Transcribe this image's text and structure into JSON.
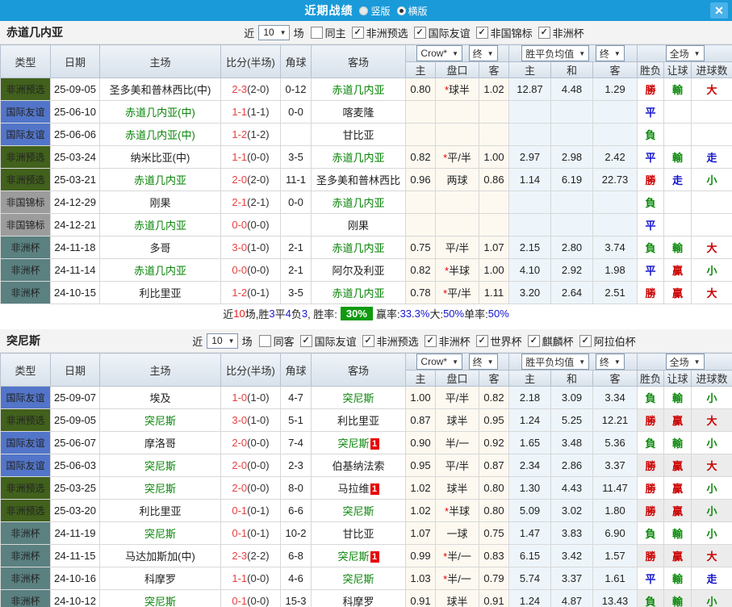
{
  "titlebar": {
    "title": "近期战绩",
    "layout_options": [
      {
        "label": "竖版",
        "selected": false
      },
      {
        "label": "横版",
        "selected": true
      }
    ],
    "close_label": "✕"
  },
  "table_header": {
    "type": "类型",
    "date": "日期",
    "home": "主场",
    "score": "比分(半场)",
    "corners": "角球",
    "away": "客场",
    "odds_group": {
      "bookmaker": "Crow*",
      "final": "终"
    },
    "mean_group": {
      "label": "胜平负均值",
      "final": "终"
    },
    "scope": "全场",
    "sub": {
      "home": "主",
      "line": "盘口",
      "away": "客",
      "m_home": "主",
      "m_draw": "和",
      "m_away": "客",
      "wl": "胜负",
      "handicap": "让球",
      "goals": "进球数"
    }
  },
  "filter_common": {
    "near": "近",
    "games": "场"
  },
  "colors": {
    "title_blue": "#1a9ad9",
    "focus_green": "#078407",
    "score_red": "#e84040",
    "win_red": "#cc0000",
    "lose_green": "#0b8a0b",
    "draw_blue": "#1515cc",
    "type_africa_qualifier": "#41611c",
    "type_friendly": "#5275c9",
    "type_non_championship": "#9c9c9c",
    "type_africa_cup": "#5a8080",
    "win_rate_badge_green": "#0f9a0f",
    "red_card_badge": "#e60000"
  },
  "sections": [
    {
      "team": "赤道几内亚",
      "count": "10",
      "same_label": "同主",
      "same_checked": false,
      "filters": [
        "非洲预选",
        "国际友谊",
        "非国锦标",
        "非洲杯"
      ],
      "rows": [
        {
          "type": "非洲预选",
          "date": "25-09-05",
          "home": "圣多美和普林西比(中)",
          "home_focus": false,
          "home_badge": "",
          "ft": "2-3",
          "ht": "(2-0)",
          "corners": "0-12",
          "away": "赤道几内亚",
          "away_focus": true,
          "away_badge": "",
          "o1": "0.80",
          "line": "*球半",
          "o2": "1.02",
          "m1": "12.87",
          "m2": "4.48",
          "m3": "1.29",
          "r1": "勝",
          "r2": "輸",
          "r3": "大"
        },
        {
          "type": "国际友谊",
          "date": "25-06-10",
          "home": "赤道几内亚(中)",
          "home_focus": true,
          "home_badge": "",
          "ft": "1-1",
          "ht": "(1-1)",
          "corners": "0-0",
          "away": "喀麦隆",
          "away_focus": false,
          "away_badge": "",
          "o1": "",
          "line": "",
          "o2": "",
          "m1": "",
          "m2": "",
          "m3": "",
          "r1": "平",
          "r2": "",
          "r3": ""
        },
        {
          "type": "国际友谊",
          "date": "25-06-06",
          "home": "赤道几内亚(中)",
          "home_focus": true,
          "home_badge": "",
          "ft": "1-2",
          "ht": "(1-2)",
          "corners": "",
          "away": "甘比亚",
          "away_focus": false,
          "away_badge": "",
          "o1": "",
          "line": "",
          "o2": "",
          "m1": "",
          "m2": "",
          "m3": "",
          "r1": "負",
          "r2": "",
          "r3": ""
        },
        {
          "type": "非洲预选",
          "date": "25-03-24",
          "home": "纳米比亚(中)",
          "home_focus": false,
          "home_badge": "",
          "ft": "1-1",
          "ht": "(0-0)",
          "corners": "3-5",
          "away": "赤道几内亚",
          "away_focus": true,
          "away_badge": "",
          "o1": "0.82",
          "line": "*平/半",
          "o2": "1.00",
          "m1": "2.97",
          "m2": "2.98",
          "m3": "2.42",
          "r1": "平",
          "r2": "輸",
          "r3": "走"
        },
        {
          "type": "非洲预选",
          "date": "25-03-21",
          "home": "赤道几内亚",
          "home_focus": true,
          "home_badge": "",
          "ft": "2-0",
          "ht": "(2-0)",
          "corners": "11-1",
          "away": "圣多美和普林西比",
          "away_focus": false,
          "away_badge": "",
          "o1": "0.96",
          "line": "两球",
          "o2": "0.86",
          "m1": "1.14",
          "m2": "6.19",
          "m3": "22.73",
          "r1": "勝",
          "r2": "走",
          "r3": "小"
        },
        {
          "type": "非国锦标",
          "date": "24-12-29",
          "home": "刚果",
          "home_focus": false,
          "home_badge": "",
          "ft": "2-1",
          "ht": "(2-1)",
          "corners": "0-0",
          "away": "赤道几内亚",
          "away_focus": true,
          "away_badge": "",
          "o1": "",
          "line": "",
          "o2": "",
          "m1": "",
          "m2": "",
          "m3": "",
          "r1": "負",
          "r2": "",
          "r3": ""
        },
        {
          "type": "非国锦标",
          "date": "24-12-21",
          "home": "赤道几内亚",
          "home_focus": true,
          "home_badge": "",
          "ft": "0-0",
          "ht": "(0-0)",
          "corners": "",
          "away": "刚果",
          "away_focus": false,
          "away_badge": "",
          "o1": "",
          "line": "",
          "o2": "",
          "m1": "",
          "m2": "",
          "m3": "",
          "r1": "平",
          "r2": "",
          "r3": ""
        },
        {
          "type": "非洲杯",
          "date": "24-11-18",
          "home": "多哥",
          "home_focus": false,
          "home_badge": "",
          "ft": "3-0",
          "ht": "(1-0)",
          "corners": "2-1",
          "away": "赤道几内亚",
          "away_focus": true,
          "away_badge": "",
          "o1": "0.75",
          "line": "平/半",
          "o2": "1.07",
          "m1": "2.15",
          "m2": "2.80",
          "m3": "3.74",
          "r1": "負",
          "r2": "輸",
          "r3": "大"
        },
        {
          "type": "非洲杯",
          "date": "24-11-14",
          "home": "赤道几内亚",
          "home_focus": true,
          "home_badge": "",
          "ft": "0-0",
          "ht": "(0-0)",
          "corners": "2-1",
          "away": "阿尔及利亚",
          "away_focus": false,
          "away_badge": "",
          "o1": "0.82",
          "line": "*半球",
          "o2": "1.00",
          "m1": "4.10",
          "m2": "2.92",
          "m3": "1.98",
          "r1": "平",
          "r2": "贏",
          "r3": "小"
        },
        {
          "type": "非洲杯",
          "date": "24-10-15",
          "home": "利比里亚",
          "home_focus": false,
          "home_badge": "",
          "ft": "1-2",
          "ht": "(0-1)",
          "corners": "3-5",
          "away": "赤道几内亚",
          "away_focus": true,
          "away_badge": "",
          "o1": "0.78",
          "line": "*平/半",
          "o2": "1.11",
          "m1": "3.20",
          "m2": "2.64",
          "m3": "2.51",
          "r1": "勝",
          "r2": "贏",
          "r3": "大"
        }
      ],
      "summary": {
        "parts": [
          {
            "t": "近",
            "c": ""
          },
          {
            "t": "10",
            "c": "red"
          },
          {
            "t": "场,胜",
            "c": ""
          },
          {
            "t": "3",
            "c": "blue"
          },
          {
            "t": "平",
            "c": ""
          },
          {
            "t": "4",
            "c": "blue"
          },
          {
            "t": "负",
            "c": ""
          },
          {
            "t": "3",
            "c": "blue"
          },
          {
            "t": ", 胜率:",
            "c": ""
          },
          {
            "t": "30%",
            "c": "badge"
          },
          {
            "t": "赢率:",
            "c": ""
          },
          {
            "t": "33.3%",
            "c": "blue"
          },
          {
            "t": " 大:",
            "c": ""
          },
          {
            "t": "50%",
            "c": "blue"
          },
          {
            "t": " 单率:",
            "c": ""
          },
          {
            "t": "50%",
            "c": "blue"
          }
        ]
      }
    },
    {
      "team": "突尼斯",
      "count": "10",
      "same_label": "同客",
      "same_checked": false,
      "filters": [
        "国际友谊",
        "非洲预选",
        "非洲杯",
        "世界杯",
        "麒麟杯",
        "阿拉伯杯"
      ],
      "rows": [
        {
          "type": "国际友谊",
          "date": "25-09-07",
          "home": "埃及",
          "home_focus": false,
          "home_badge": "",
          "ft": "1-0",
          "ht": "(1-0)",
          "corners": "4-7",
          "away": "突尼斯",
          "away_focus": true,
          "away_badge": "",
          "o1": "1.00",
          "line": "平/半",
          "o2": "0.82",
          "m1": "2.18",
          "m2": "3.09",
          "m3": "3.34",
          "r1": "負",
          "r2": "輸",
          "r3": "小"
        },
        {
          "type": "非洲预选",
          "date": "25-09-05",
          "home": "突尼斯",
          "home_focus": true,
          "home_badge": "",
          "ft": "3-0",
          "ht": "(1-0)",
          "corners": "5-1",
          "away": "利比里亚",
          "away_focus": false,
          "away_badge": "",
          "o1": "0.87",
          "line": "球半",
          "o2": "0.95",
          "m1": "1.24",
          "m2": "5.25",
          "m3": "12.21",
          "r1": "勝",
          "r2": "贏",
          "r3": "大"
        },
        {
          "type": "国际友谊",
          "date": "25-06-07",
          "home": "摩洛哥",
          "home_focus": false,
          "home_badge": "",
          "ft": "2-0",
          "ht": "(0-0)",
          "corners": "7-4",
          "away": "突尼斯",
          "away_focus": true,
          "away_badge": "1",
          "o1": "0.90",
          "line": "半/一",
          "o2": "0.92",
          "m1": "1.65",
          "m2": "3.48",
          "m3": "5.36",
          "r1": "負",
          "r2": "輸",
          "r3": "小"
        },
        {
          "type": "国际友谊",
          "date": "25-06-03",
          "home": "突尼斯",
          "home_focus": true,
          "home_badge": "",
          "ft": "2-0",
          "ht": "(0-0)",
          "corners": "2-3",
          "away": "伯基纳法索",
          "away_focus": false,
          "away_badge": "",
          "o1": "0.95",
          "line": "平/半",
          "o2": "0.87",
          "m1": "2.34",
          "m2": "2.86",
          "m3": "3.37",
          "r1": "勝",
          "r2": "贏",
          "r3": "大"
        },
        {
          "type": "非洲预选",
          "date": "25-03-25",
          "home": "突尼斯",
          "home_focus": true,
          "home_badge": "",
          "ft": "2-0",
          "ht": "(0-0)",
          "corners": "8-0",
          "away": "马拉维",
          "away_focus": false,
          "away_badge": "1",
          "o1": "1.02",
          "line": "球半",
          "o2": "0.80",
          "m1": "1.30",
          "m2": "4.43",
          "m3": "11.47",
          "r1": "勝",
          "r2": "贏",
          "r3": "小"
        },
        {
          "type": "非洲预选",
          "date": "25-03-20",
          "home": "利比里亚",
          "home_focus": false,
          "home_badge": "",
          "ft": "0-1",
          "ht": "(0-1)",
          "corners": "6-6",
          "away": "突尼斯",
          "away_focus": true,
          "away_badge": "",
          "o1": "1.02",
          "line": "*半球",
          "o2": "0.80",
          "m1": "5.09",
          "m2": "3.02",
          "m3": "1.80",
          "r1": "勝",
          "r2": "贏",
          "r3": "小"
        },
        {
          "type": "非洲杯",
          "date": "24-11-19",
          "home": "突尼斯",
          "home_focus": true,
          "home_badge": "",
          "ft": "0-1",
          "ht": "(0-1)",
          "corners": "10-2",
          "away": "甘比亚",
          "away_focus": false,
          "away_badge": "",
          "o1": "1.07",
          "line": "一球",
          "o2": "0.75",
          "m1": "1.47",
          "m2": "3.83",
          "m3": "6.90",
          "r1": "負",
          "r2": "輸",
          "r3": "小"
        },
        {
          "type": "非洲杯",
          "date": "24-11-15",
          "home": "马达加斯加(中)",
          "home_focus": false,
          "home_badge": "",
          "ft": "2-3",
          "ht": "(2-2)",
          "corners": "6-8",
          "away": "突尼斯",
          "away_focus": true,
          "away_badge": "1",
          "o1": "0.99",
          "line": "*半/一",
          "o2": "0.83",
          "m1": "6.15",
          "m2": "3.42",
          "m3": "1.57",
          "r1": "勝",
          "r2": "贏",
          "r3": "大"
        },
        {
          "type": "非洲杯",
          "date": "24-10-16",
          "home": "科摩罗",
          "home_focus": false,
          "home_badge": "",
          "ft": "1-1",
          "ht": "(0-0)",
          "corners": "4-6",
          "away": "突尼斯",
          "away_focus": true,
          "away_badge": "",
          "o1": "1.03",
          "line": "*半/一",
          "o2": "0.79",
          "m1": "5.74",
          "m2": "3.37",
          "m3": "1.61",
          "r1": "平",
          "r2": "輸",
          "r3": "走"
        },
        {
          "type": "非洲杯",
          "date": "24-10-12",
          "home": "突尼斯",
          "home_focus": true,
          "home_badge": "",
          "ft": "0-1",
          "ht": "(0-0)",
          "corners": "15-3",
          "away": "科摩罗",
          "away_focus": false,
          "away_badge": "",
          "o1": "0.91",
          "line": "球半",
          "o2": "0.91",
          "m1": "1.24",
          "m2": "4.87",
          "m3": "13.43",
          "r1": "負",
          "r2": "輸",
          "r3": "小"
        }
      ]
    }
  ]
}
